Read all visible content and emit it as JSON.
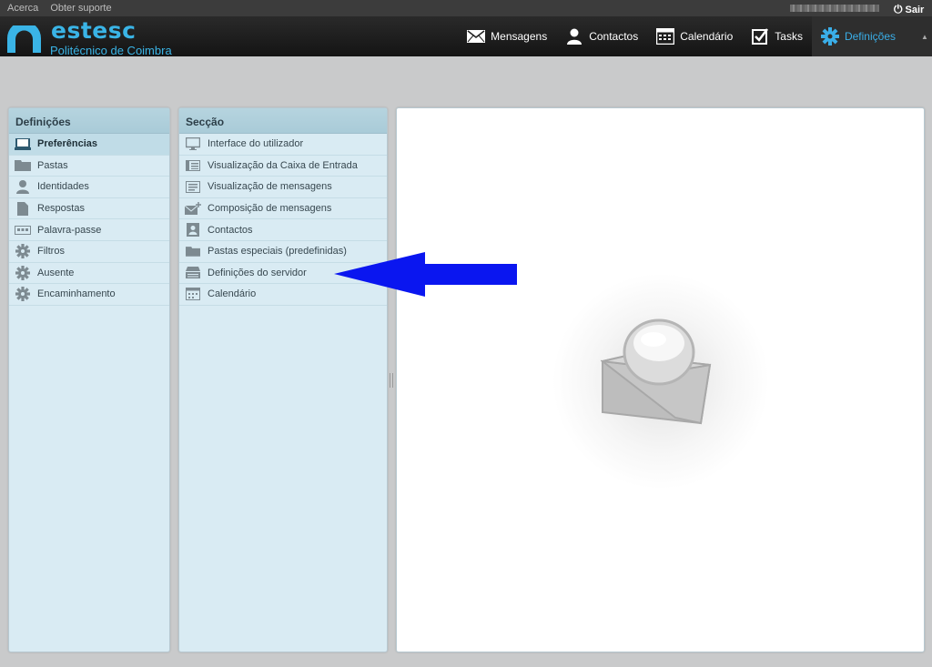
{
  "topbar": {
    "about": "Acerca",
    "support": "Obter suporte",
    "logout": "Sair"
  },
  "brand": {
    "name": "estesc",
    "subtitle": "Politécnico de Coimbra",
    "color": "#3ab4e6"
  },
  "nav": {
    "items": [
      {
        "label": "Mensagens",
        "icon": "envelope-icon"
      },
      {
        "label": "Contactos",
        "icon": "person-icon"
      },
      {
        "label": "Calendário",
        "icon": "calendar-icon"
      },
      {
        "label": "Tasks",
        "icon": "checkbox-icon"
      },
      {
        "label": "Definições",
        "icon": "gear-icon",
        "active": true
      }
    ]
  },
  "settings_panel": {
    "title": "Definições",
    "items": [
      {
        "label": "Preferências",
        "icon": "laptop-icon",
        "selected": true
      },
      {
        "label": "Pastas",
        "icon": "folder-icon"
      },
      {
        "label": "Identidades",
        "icon": "person-icon"
      },
      {
        "label": "Respostas",
        "icon": "document-icon"
      },
      {
        "label": "Palavra-passe",
        "icon": "password-icon"
      },
      {
        "label": "Filtros",
        "icon": "gear-icon"
      },
      {
        "label": "Ausente",
        "icon": "gear-icon"
      },
      {
        "label": "Encaminhamento",
        "icon": "gear-icon"
      }
    ]
  },
  "section_panel": {
    "title": "Secção",
    "items": [
      {
        "label": "Interface do utilizador",
        "icon": "monitor-icon"
      },
      {
        "label": "Visualização da Caixa de Entrada",
        "icon": "list-view-icon"
      },
      {
        "label": "Visualização de mensagens",
        "icon": "message-view-icon"
      },
      {
        "label": "Composição de mensagens",
        "icon": "compose-icon"
      },
      {
        "label": "Contactos",
        "icon": "contact-card-icon"
      },
      {
        "label": "Pastas especiais (predefinidas)",
        "icon": "folder-icon"
      },
      {
        "label": "Definições do servidor",
        "icon": "server-icon"
      },
      {
        "label": "Calendário",
        "icon": "calendar-icon"
      }
    ]
  },
  "annotation": {
    "arrow_color": "#0a16f0",
    "points_to": "Definições do servidor"
  }
}
